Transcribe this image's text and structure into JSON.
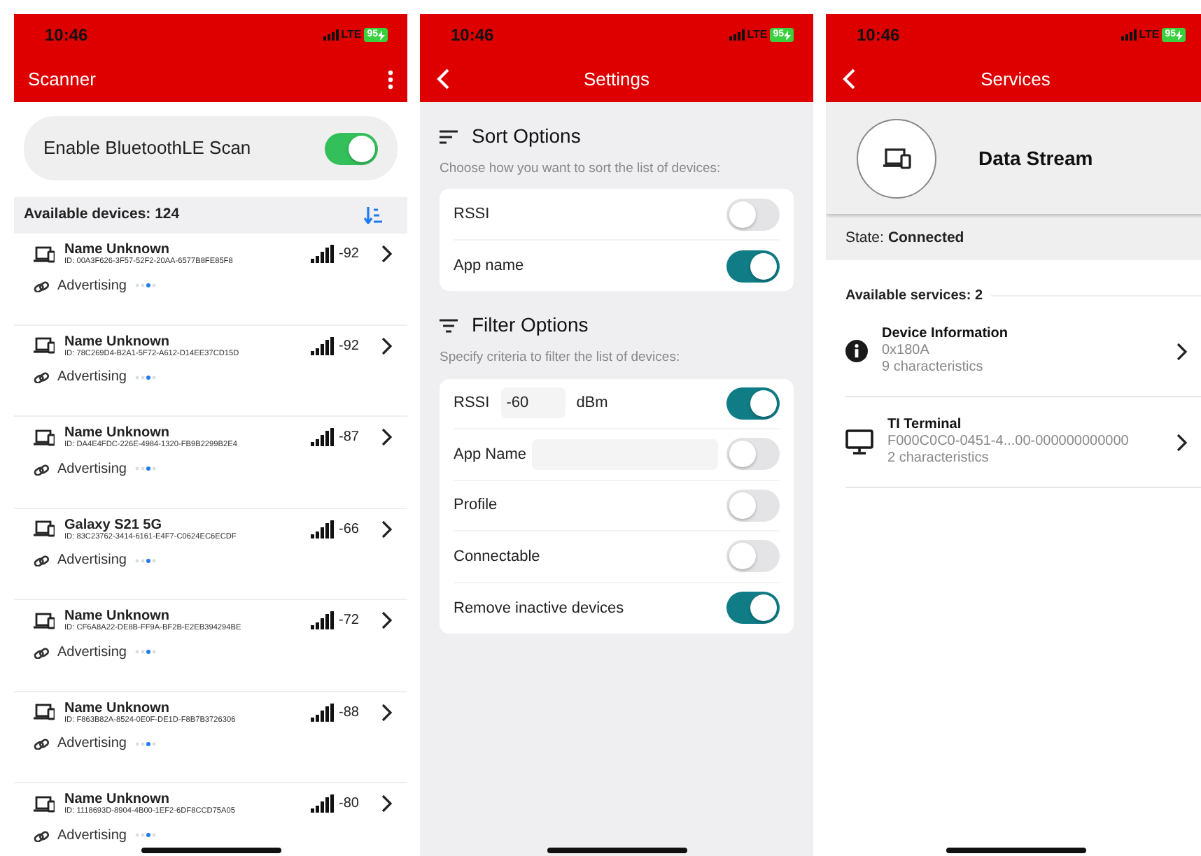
{
  "screens": [
    {
      "kind": "scanner",
      "status": {
        "time": "10:46",
        "network": "LTE",
        "battery": "95"
      },
      "title": "Scanner",
      "scan_toggle": {
        "label": "Enable BluetoothLE Scan",
        "on": true
      },
      "available": "Available devices: 124",
      "devices": [
        {
          "name": "Name Unknown",
          "id": "ID: 00A3F626-3F57-52F2-20AA-6577B8FE85F8",
          "rssi": "-92",
          "status": "Advertising"
        },
        {
          "name": "Name Unknown",
          "id": "ID: 78C269D4-B2A1-5F72-A612-D14EE37CD15D",
          "rssi": "-92",
          "status": "Advertising"
        },
        {
          "name": "Name Unknown",
          "id": "ID: DA4E4FDC-226E-4984-1320-FB9B2299B2E4",
          "rssi": "-87",
          "status": "Advertising"
        },
        {
          "name": "Galaxy S21 5G",
          "id": "ID: 83C23762-3414-6161-E4F7-C0624EC6ECDF",
          "rssi": "-66",
          "status": "Advertising"
        },
        {
          "name": "Name Unknown",
          "id": "ID: CF6A8A22-DE8B-FF9A-BF2B-E2EB394294BE",
          "rssi": "-72",
          "status": "Advertising"
        },
        {
          "name": "Name Unknown",
          "id": "ID: F863B82A-8524-0E0F-DE1D-F8B7B3726306",
          "rssi": "-88",
          "status": "Advertising"
        },
        {
          "name": "Name Unknown",
          "id": "ID: 1118693D-8904-4B00-1EF2-6DF8CCD75A05",
          "rssi": "-80",
          "status": "Advertising"
        }
      ]
    },
    {
      "kind": "settings",
      "status": {
        "time": "10:46",
        "network": "LTE",
        "battery": "95"
      },
      "title": "Settings",
      "sections": [
        {
          "kind": "sort",
          "heading": "Sort Options",
          "hint": "Choose how you want to sort the list of devices:",
          "rows": [
            {
              "kind": "plain",
              "label": "RSSI",
              "on": false
            },
            {
              "kind": "plain",
              "label": "App name",
              "on": true
            }
          ]
        },
        {
          "kind": "filter",
          "heading": "Filter Options",
          "hint": "Specify criteria to filter the list of devices:",
          "rows": [
            {
              "kind": "value",
              "label": "RSSI",
              "value": "-60",
              "unit": "dBm",
              "on": true
            },
            {
              "kind": "field",
              "label": "App Name",
              "on": false
            },
            {
              "kind": "plain",
              "label": "Profile",
              "on": false
            },
            {
              "kind": "plain",
              "label": "Connectable",
              "on": false
            },
            {
              "kind": "plain",
              "label": "Remove inactive devices",
              "on": true
            }
          ]
        }
      ]
    },
    {
      "kind": "services",
      "status": {
        "time": "10:46",
        "network": "LTE",
        "battery": "95"
      },
      "title": "Services",
      "device": "Data Stream",
      "state_label": "State:",
      "state": "Connected",
      "available": "Available services: 2",
      "services": [
        {
          "kind": "info",
          "name": "Device Information",
          "uuid": "0x180A",
          "count": "9 characteristics"
        },
        {
          "kind": "terminal",
          "name": "TI Terminal",
          "uuid": "F000C0C0-0451-4...00-000000000000",
          "count": "2 characteristics"
        }
      ]
    }
  ]
}
